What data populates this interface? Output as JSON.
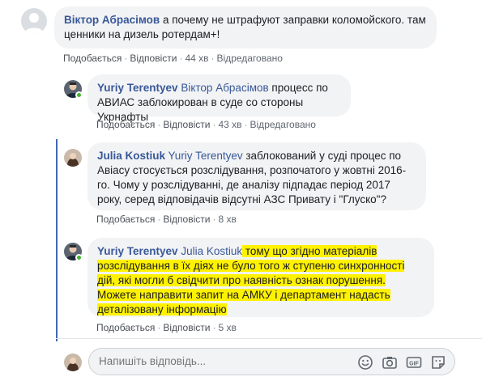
{
  "comments": [
    {
      "author": "Віктор Абрасімов",
      "text": " а почему не штрафуют заправки коломойского. там ценники на дизель ротердам+!",
      "actions": {
        "like": "Подобається",
        "reply": "Відповісти",
        "time": "44 хв",
        "edited": "Відредаговано"
      }
    },
    {
      "author": "Yuriy Terentyev",
      "mention": "Віктор Абрасімов",
      "text": " процесс по АВИАС заблокирован в суде со стороны Укрнафты",
      "actions": {
        "like": "Подобається",
        "reply": "Відповісти",
        "time": "43 хв",
        "edited": "Відредаговано"
      }
    },
    {
      "author": "Julia Kostiuk",
      "mention": "Yuriy Terentyev",
      "text": " заблокований у суді процес по Авіасу стосується розслідування, розпочатого у жовтні 2016-го. Чому у розслідуванні, де аналізу підпадає період 2017 року, серед відповідачів відсутні АЗС Привату і \"Глуско\"?",
      "actions": {
        "like": "Подобається",
        "reply": "Відповісти",
        "time": "8 хв"
      }
    },
    {
      "author": "Yuriy Terentyev",
      "mention": "Julia Kostiuk",
      "text_line1": " тому що згідно матеріалів",
      "text_line2": "розслідування в їх діях не було того ж ступеню синхронності",
      "text_line3": "дій, які могли б свідчити про наявність ознак порушення.",
      "text_line4": "Можете направити запит на АМКУ і департамент надасть",
      "text_line5": "деталізовану інформацію",
      "actions": {
        "like": "Подобається",
        "reply": "Відповісти",
        "time": "5 хв"
      }
    }
  ],
  "reply_box": {
    "placeholder": "Напишіть відповідь..."
  },
  "icons": [
    "emoji-icon",
    "camera-icon",
    "gif-icon",
    "sticker-icon"
  ],
  "colors": {
    "link": "#385898",
    "highlight": "#fff200",
    "thread": "#4267b2",
    "online": "#42b72a"
  }
}
